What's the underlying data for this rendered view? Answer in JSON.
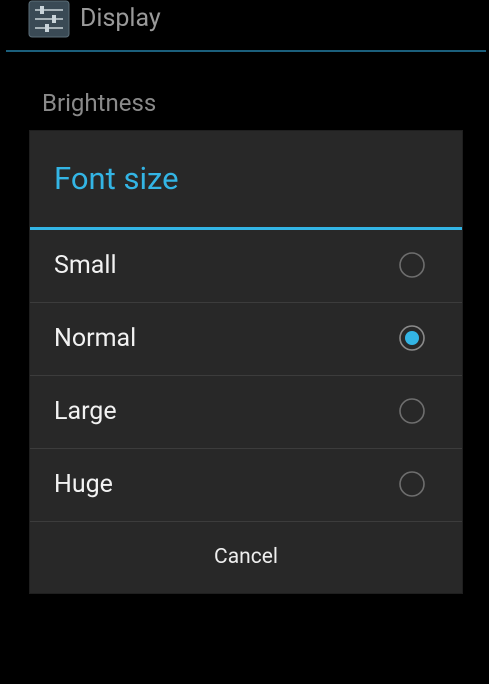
{
  "action_bar": {
    "title": "Display",
    "icon": "settings-sliders-icon"
  },
  "background_list": {
    "items": [
      {
        "label": "Brightness"
      }
    ]
  },
  "dialog": {
    "title": "Font size",
    "options": [
      {
        "label": "Small",
        "selected": false
      },
      {
        "label": "Normal",
        "selected": true
      },
      {
        "label": "Large",
        "selected": false
      },
      {
        "label": "Huge",
        "selected": false
      }
    ],
    "cancel_label": "Cancel"
  },
  "colors": {
    "accent": "#33b5e5",
    "dialog_background": "#282828",
    "screen_background": "#000000"
  }
}
